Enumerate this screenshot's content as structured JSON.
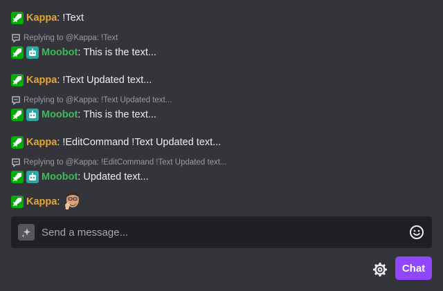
{
  "messages": [
    {
      "type": "msg",
      "badges": [
        "sword-icon"
      ],
      "user": "Kappa",
      "text": "!Text"
    },
    {
      "type": "reply",
      "reply_text": "Replying to @Kappa: !Text"
    },
    {
      "type": "msg",
      "badges": [
        "sword-icon",
        "robot-icon"
      ],
      "user": "Moobot",
      "text": "This is the text..."
    },
    {
      "type": "msg",
      "badges": [
        "sword-icon"
      ],
      "user": "Kappa",
      "text": "!Text Updated text..."
    },
    {
      "type": "reply",
      "reply_text": "Replying to @Kappa: !Text Updated text..."
    },
    {
      "type": "msg",
      "badges": [
        "sword-icon",
        "robot-icon"
      ],
      "user": "Moobot",
      "text": "This is the text..."
    },
    {
      "type": "msg",
      "badges": [
        "sword-icon"
      ],
      "user": "Kappa",
      "text": "!EditCommand !Text Updated text..."
    },
    {
      "type": "reply",
      "reply_text": "Replying to @Kappa: !EditCommand !Text Updated text..."
    },
    {
      "type": "msg",
      "badges": [
        "sword-icon",
        "robot-icon"
      ],
      "user": "Moobot",
      "text": "Updated text..."
    },
    {
      "type": "msg",
      "badges": [
        "sword-icon"
      ],
      "user": "Kappa",
      "text": "",
      "emote": "face-emote"
    }
  ],
  "input": {
    "placeholder": "Send a message..."
  },
  "buttons": {
    "chat_label": "Chat"
  },
  "colors": {
    "kappa": "#e9a52a",
    "moobot": "#3fb95e",
    "accent": "#9147ff",
    "mod_badge": "#00ad03",
    "bot_badge": "#2aa9a4"
  }
}
